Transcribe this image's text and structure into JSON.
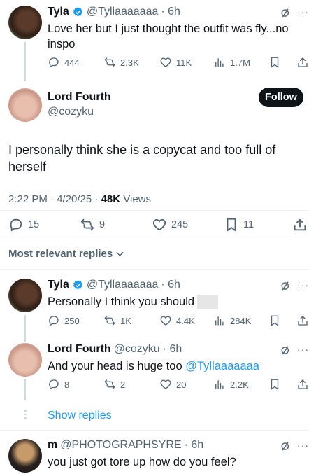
{
  "colors": {
    "accent": "#1d9bf0",
    "text": "#0f1419",
    "muted": "#536471",
    "divider": "#eff3f4"
  },
  "tweet1": {
    "name": "Tyla",
    "handle": "@Tyllaaaaaaa",
    "time": "· 6h",
    "text": "Love her but I just thought the outfit was fly...no inspo",
    "stats": {
      "replies": "444",
      "reposts": "2.3K",
      "likes": "11K",
      "views": "1.7M"
    }
  },
  "main": {
    "name": "Lord Fourth",
    "handle": "@cozyku",
    "follow_label": "Follow",
    "text": "I personally think she is a copycat and too full of herself",
    "time": "2:22 PM · 4/20/25 · ",
    "views_count": "48K",
    "views_label": " Views",
    "stats": {
      "replies": "15",
      "reposts": "9",
      "likes": "245",
      "bookmarks": "11"
    }
  },
  "sort_label": "Most relevant replies",
  "reply1": {
    "name": "Tyla",
    "handle": "@Tyllaaaaaaa",
    "time": "· 6h",
    "text": "Personally I think you should",
    "stats": {
      "replies": "250",
      "reposts": "1K",
      "likes": "4.4K",
      "views": "284K"
    }
  },
  "reply2": {
    "name": "Lord Fourth",
    "handle": "@cozyku",
    "time": "· 6h",
    "text": "And your head is huge too ",
    "mention": "@Tyllaaaaaaa",
    "stats": {
      "replies": "8",
      "reposts": "2",
      "likes": "20",
      "views": "2.2K"
    }
  },
  "show_replies_label": "Show replies",
  "reply3": {
    "name": "m",
    "handle": "@PHOTOGRAPHSYRE",
    "time": "· 6h",
    "text": "you just got tore up how do you feel?"
  },
  "more_glyph": "···"
}
